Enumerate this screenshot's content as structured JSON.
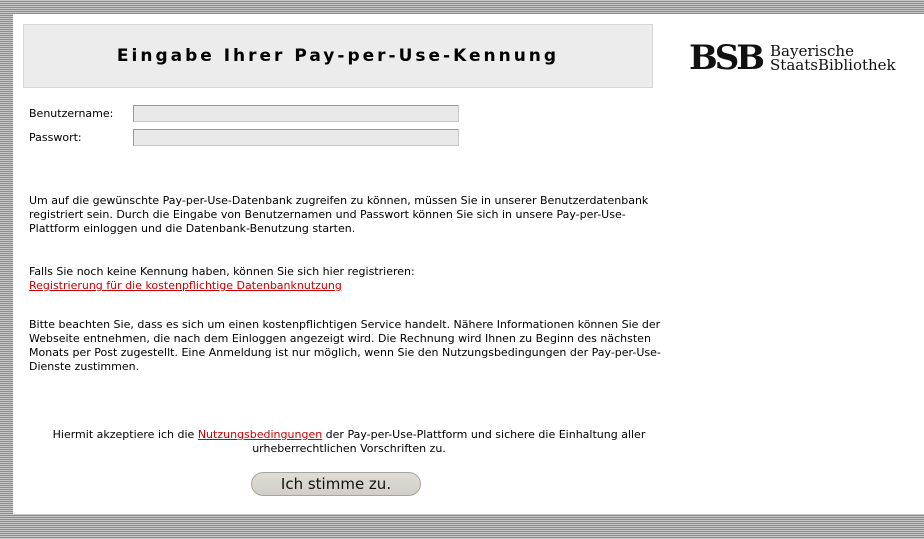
{
  "header": {
    "title": "Eingabe Ihrer Pay-per-Use-Kennung",
    "logo_mark": "BSB",
    "logo_line1": "Bayerische",
    "logo_line2": "StaatsBibliothek"
  },
  "form": {
    "username_label": "Benutzername:",
    "username_value": "",
    "password_label": "Passwort:",
    "password_value": ""
  },
  "info": {
    "p1": "Um auf die gewünschte Pay-per-Use-Datenbank zugreifen zu können, müssen Sie in unserer Benutzerdatenbank registriert sein. Durch die Eingabe von Benutzernamen und Passwort können Sie sich in unsere Pay-per-Use-Plattform einloggen und die Datenbank-Benutzung starten.",
    "p2": "Falls Sie noch keine Kennung haben, können Sie sich hier registrieren:",
    "register_link": "Registrierung für die kostenpflichtige Datenbanknutzung",
    "p3": "Bitte beachten Sie, dass es sich um einen kostenpflichtigen Service handelt. Nähere Informationen können Sie der Webseite entnehmen, die nach dem Einloggen angezeigt wird. Die Rechnung wird Ihnen zu Beginn des nächsten Monats per Post zugestellt. Eine Anmeldung ist nur möglich, wenn Sie den Nutzungsbedingungen der Pay-per-Use-Dienste zustimmen."
  },
  "accept": {
    "before": "Hiermit akzeptiere ich die ",
    "terms_link": "Nutzungsbedingungen",
    "after": " der Pay-per-Use-Plattform und sichere die Einhaltung aller urheberrechtlichen Vorschriften zu.",
    "button_label": "Ich stimme zu."
  }
}
